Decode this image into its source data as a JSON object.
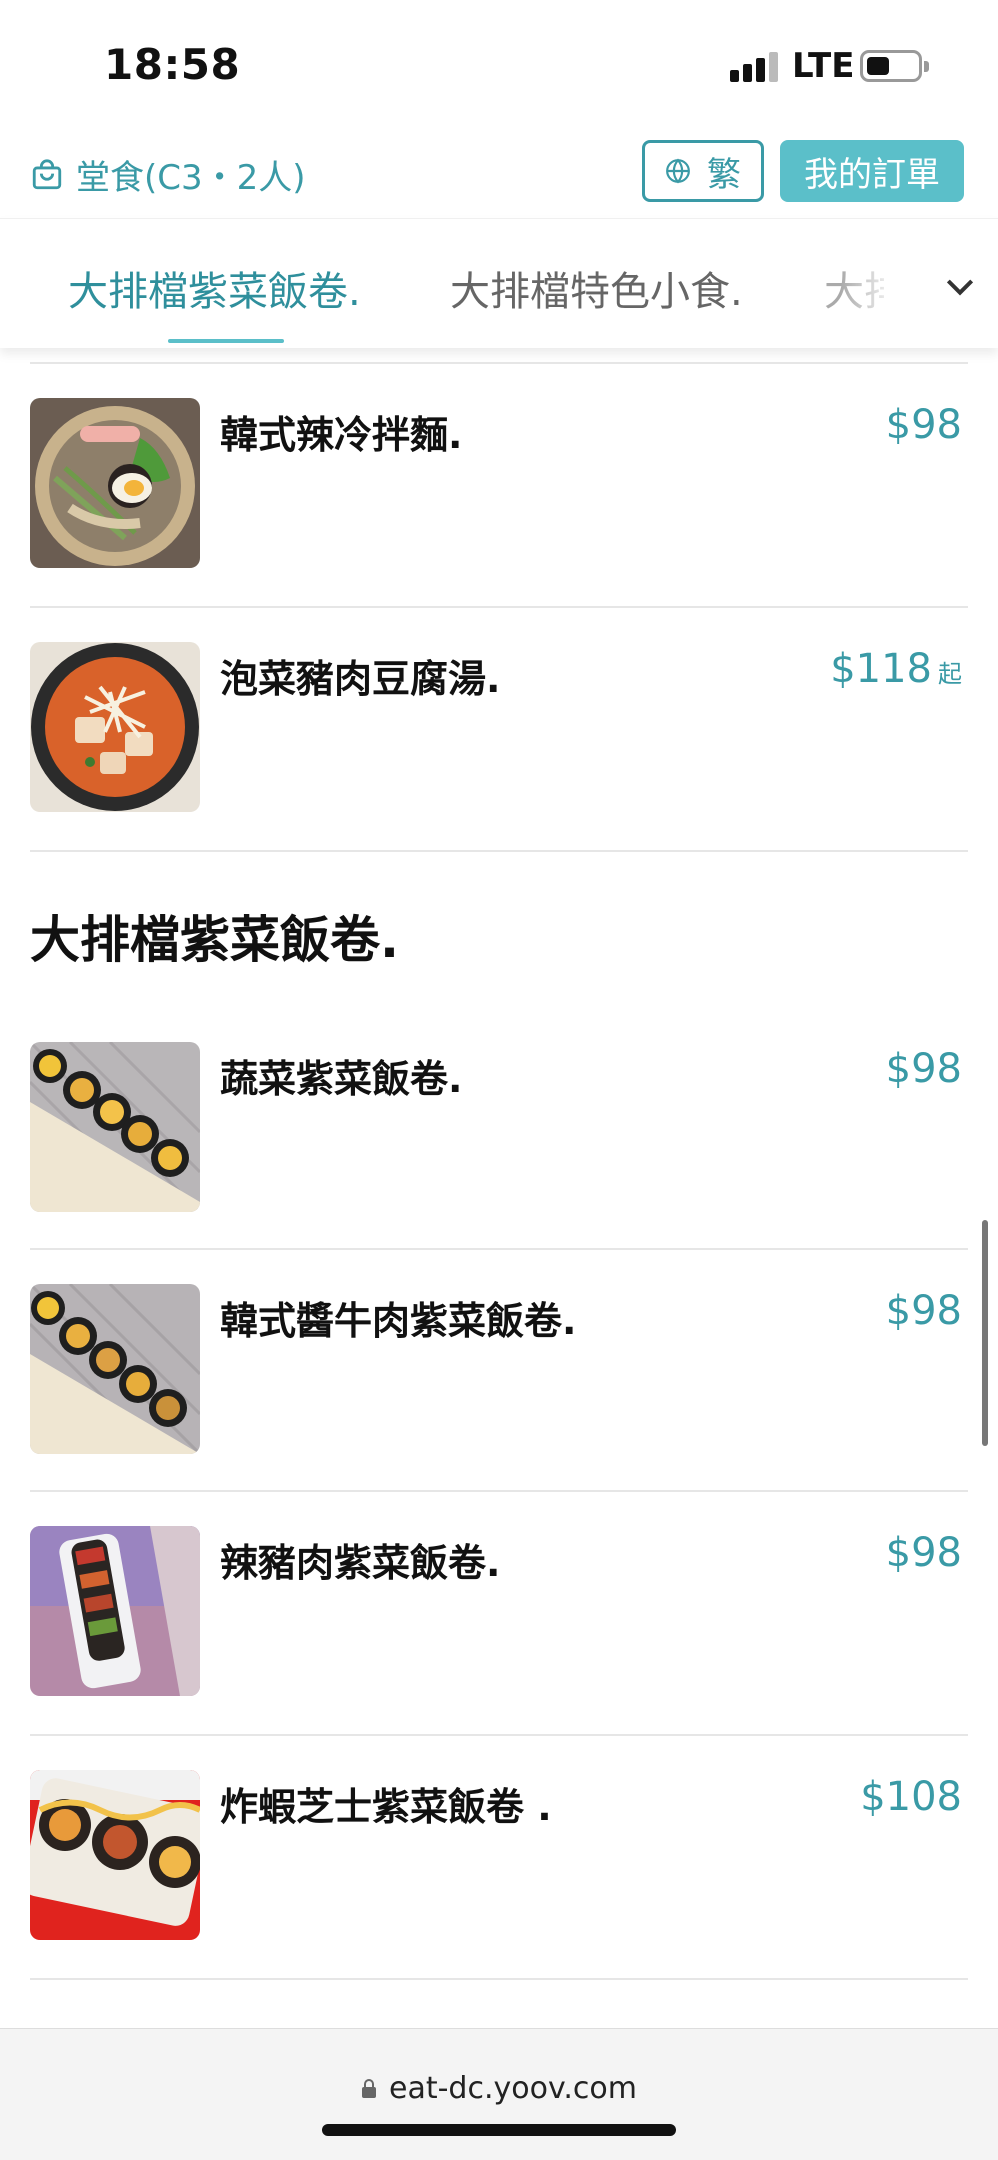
{
  "status_bar": {
    "time": "18:58",
    "network": "LTE",
    "battery_level": 0.35
  },
  "header": {
    "dine_in_label": "堂食(C3・2人)",
    "language_label": "繁",
    "orders_label": "我的訂單"
  },
  "tabs": [
    {
      "label": "大排檔紫菜飯卷.",
      "active": true
    },
    {
      "label": "大排檔特色小食.",
      "active": false
    },
    {
      "label": "大排",
      "active": false
    }
  ],
  "menu": {
    "previous_items": [
      {
        "name": "韓式辣冷拌麵.",
        "price": "$98",
        "price_suffix": "",
        "image": "cold-noodles-bowl-image"
      },
      {
        "name": "泡菜豬肉豆腐湯.",
        "price": "$118",
        "price_suffix": "起",
        "image": "kimchi-tofu-soup-image"
      }
    ],
    "section_title": "大排檔紫菜飯卷.",
    "items": [
      {
        "name": "蔬菜紫菜飯卷.",
        "price": "$98",
        "price_suffix": "",
        "image": "vegetable-kimbap-image"
      },
      {
        "name": "韓式醬牛肉紫菜飯卷.",
        "price": "$98",
        "price_suffix": "",
        "image": "beef-kimbap-image"
      },
      {
        "name": "辣豬肉紫菜飯卷.",
        "price": "$98",
        "price_suffix": "",
        "image": "spicy-pork-kimbap-image"
      },
      {
        "name": "炸蝦芝士紫菜飯卷 .",
        "price": "$108",
        "price_suffix": "",
        "image": "shrimp-cheese-kimbap-image"
      }
    ]
  },
  "browser": {
    "url": "eat-dc.yoov.com"
  },
  "colors": {
    "accent": "#3a9aa6",
    "accent_fill": "#5bbfc9",
    "text": "#111111",
    "divider": "#e6e6e6"
  }
}
